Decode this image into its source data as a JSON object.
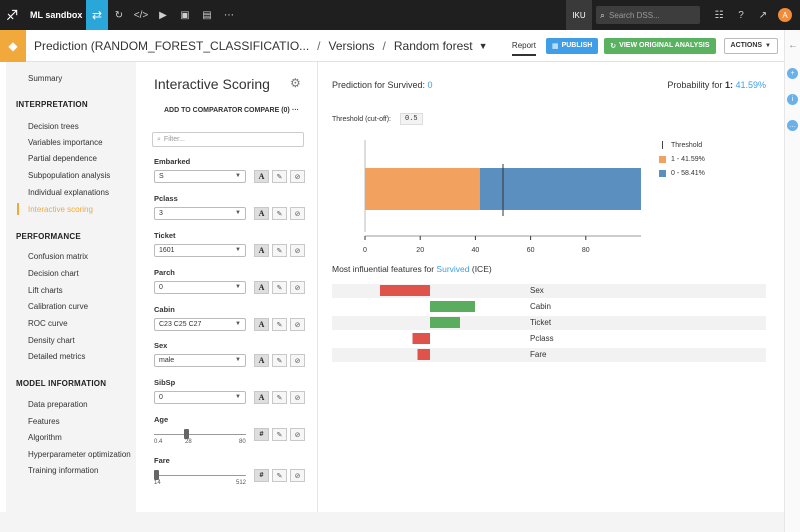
{
  "topbar": {
    "app_name": "ML sandbox",
    "user_badge": "IKU",
    "search_placeholder": "Search DSS...",
    "avatar_letter": "A"
  },
  "subbar": {
    "crumb_model": "Prediction (RANDOM_FOREST_CLASSIFICATIO...",
    "crumb_versions": "Versions",
    "crumb_algo": "Random forest",
    "report_tab": "Report",
    "publish_label": "PUBLISH",
    "view_label": "VIEW ORIGINAL ANALYSIS",
    "actions_label": "ACTIONS"
  },
  "nav": {
    "summary": "Summary",
    "interpretation_head": "INTERPRETATION",
    "interpretation_items": [
      "Decision trees",
      "Variables importance",
      "Partial dependence",
      "Subpopulation analysis",
      "Individual explanations",
      "Interactive scoring"
    ],
    "performance_head": "PERFORMANCE",
    "performance_items": [
      "Confusion matrix",
      "Decision chart",
      "Lift charts",
      "Calibration curve",
      "ROC curve",
      "Density chart",
      "Detailed metrics"
    ],
    "model_info_head": "MODEL INFORMATION",
    "model_info_items": [
      "Data preparation",
      "Features",
      "Algorithm",
      "Hyperparameter optimization",
      "Training information"
    ]
  },
  "scoring": {
    "title": "Interactive Scoring",
    "add_comparator": "ADD TO COMPARATOR",
    "compare": "COMPARE (0)",
    "more": "···",
    "filter_placeholder": "Filter...",
    "features": [
      {
        "label": "Embarked",
        "value": "S"
      },
      {
        "label": "Pclass",
        "value": "3"
      },
      {
        "label": "Ticket",
        "value": "1601"
      },
      {
        "label": "Parch",
        "value": "0"
      },
      {
        "label": "Cabin",
        "value": "C23 C25 C27"
      },
      {
        "label": "Sex",
        "value": "male"
      },
      {
        "label": "SibSp",
        "value": "0"
      }
    ],
    "sliders": [
      {
        "label": "Age",
        "min": "0.4",
        "value": "28",
        "max": "80",
        "fraction": 0.35
      },
      {
        "label": "Fare",
        "min": "14",
        "max": "512",
        "fraction": 0.0
      }
    ]
  },
  "prediction": {
    "prefix": "Prediction for Survived: ",
    "value": "0",
    "prob_prefix": "Probability for ",
    "prob_class": "1:",
    "prob_value": "41.59%",
    "threshold_label": "Threshold (cut-off):",
    "threshold_value": "0.5"
  },
  "chart_data": [
    {
      "type": "bar",
      "orientation": "horizontal-stacked",
      "series": [
        {
          "name": "1 - 41.59%",
          "value": 41.59,
          "color": "#f2a15f"
        },
        {
          "name": "0 - 58.41%",
          "value": 58.41,
          "color": "#5b8fbf"
        }
      ],
      "threshold": 50,
      "xticks": [
        "0",
        "20",
        "40",
        "60",
        "80"
      ],
      "xlim": [
        0,
        100
      ],
      "legend_title": "Threshold",
      "legend_position": "right"
    },
    {
      "type": "bar",
      "orientation": "horizontal-diverging",
      "title_prefix": "Most influential features for ",
      "title_target": "Survived",
      "title_suffix": " (ICE)",
      "categories": [
        "Sex",
        "Cabin",
        "Ticket",
        "Pclass",
        "Fare"
      ],
      "values": [
        -0.2,
        0.18,
        0.12,
        -0.07,
        -0.05
      ],
      "positive_color": "#5aac5f",
      "negative_color": "#e0534a"
    }
  ]
}
